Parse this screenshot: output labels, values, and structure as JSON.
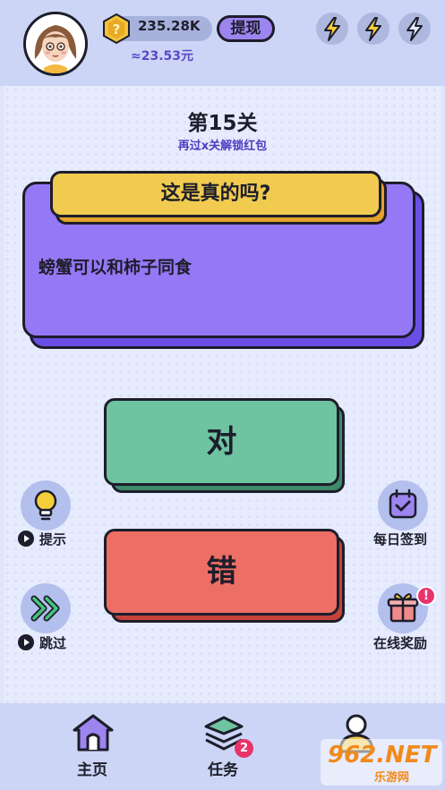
{
  "header": {
    "coin_balance": "235.28K",
    "withdraw_label": "提现",
    "cash_equivalent": "≈23.53元",
    "energy_icons": [
      "lightning-icon",
      "lightning-icon",
      "lightning-outline-icon"
    ]
  },
  "level": {
    "title": "第15关",
    "subtitle": "再过x关解锁红包"
  },
  "question": {
    "header": "这是真的吗?",
    "statement": "螃蟹可以和柿子同食"
  },
  "answers": {
    "true_label": "对",
    "false_label": "错"
  },
  "side_actions": {
    "hint_label": "提示",
    "skip_label": "跳过",
    "daily_checkin_label": "每日签到",
    "online_reward_label": "在线奖励",
    "online_reward_alert": "!"
  },
  "bottom_nav": {
    "items": [
      {
        "label": "主页",
        "icon": "home-icon"
      },
      {
        "label": "任务",
        "icon": "layers-icon",
        "badge": "2"
      },
      {
        "label": "",
        "icon": "profile-icon"
      }
    ]
  },
  "watermark": {
    "brand": "962.NET",
    "sub": "乐游网"
  },
  "colors": {
    "true_button": "#6ec4a0",
    "false_button": "#ed6e65",
    "card": "#9578f6",
    "question_tab": "#f0cb50",
    "accent_purple": "#5a48c8"
  }
}
